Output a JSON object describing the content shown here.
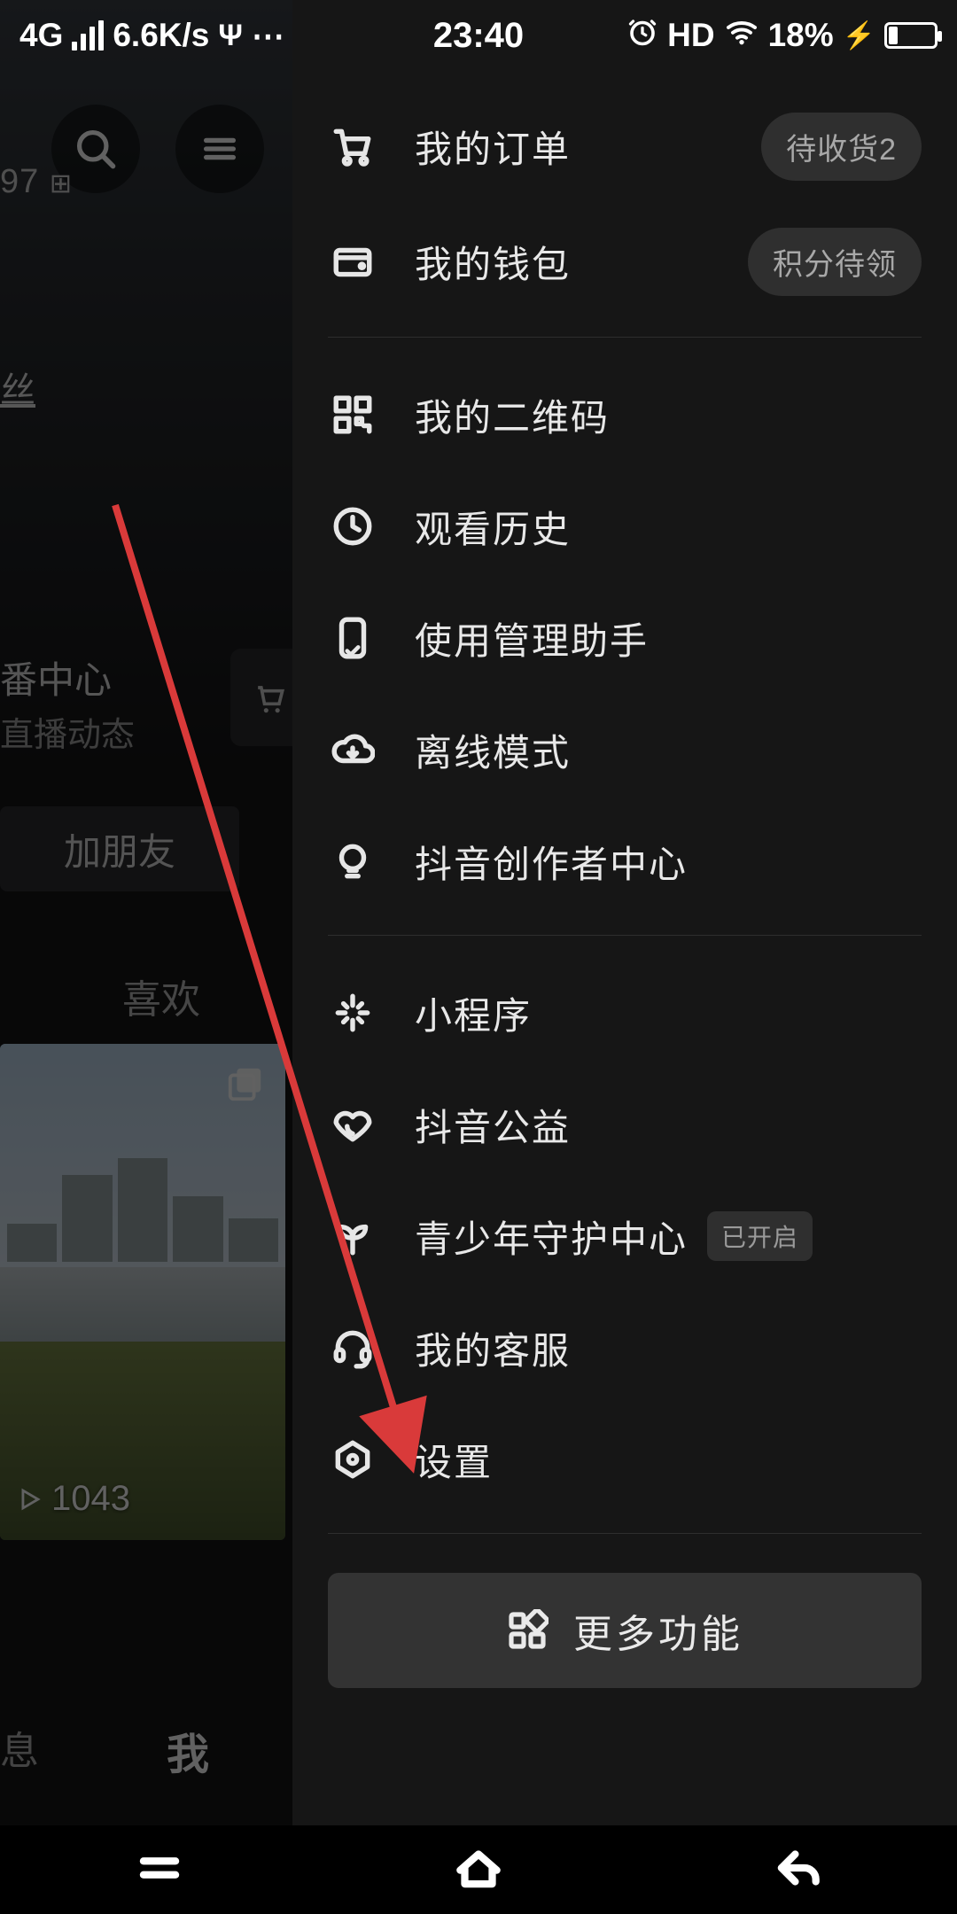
{
  "status_bar": {
    "network_type": "4G",
    "data_rate": "6.6K/s",
    "usb_symbol": "⏆",
    "more_symbol": "⋯",
    "time": "23:40",
    "hd_label": "HD",
    "battery_percent": "18%"
  },
  "background_profile": {
    "small_number": "97",
    "fans_label": "丝",
    "live_title": "番中心",
    "live_subtitle": "直播动态",
    "add_friend_label": "加朋友",
    "tab_like_label": "喜欢",
    "thumb_view_count": "1043",
    "nav_message_label": "息",
    "nav_me_label": "我"
  },
  "drawer": {
    "section1": [
      {
        "key": "orders",
        "label": "我的订单",
        "badge": "待收货2",
        "icon": "cart-icon"
      },
      {
        "key": "wallet",
        "label": "我的钱包",
        "badge": "积分待领",
        "icon": "wallet-icon"
      }
    ],
    "section2": [
      {
        "key": "qrcode",
        "label": "我的二维码",
        "icon": "qrcode-icon"
      },
      {
        "key": "history",
        "label": "观看历史",
        "icon": "clock-icon"
      },
      {
        "key": "assist",
        "label": "使用管理助手",
        "icon": "phone-check-icon"
      },
      {
        "key": "offline",
        "label": "离线模式",
        "icon": "cloud-download-icon"
      },
      {
        "key": "creator",
        "label": "抖音创作者中心",
        "icon": "bulb-icon"
      }
    ],
    "section3": [
      {
        "key": "miniapp",
        "label": "小程序",
        "icon": "spark-icon"
      },
      {
        "key": "charity",
        "label": "抖音公益",
        "icon": "heart-icon"
      },
      {
        "key": "youth",
        "label": "青少年守护中心",
        "icon": "sprout-icon",
        "tag": "已开启"
      },
      {
        "key": "support",
        "label": "我的客服",
        "icon": "headset-icon"
      },
      {
        "key": "settings",
        "label": "设置",
        "icon": "settings-icon"
      }
    ],
    "more_button_label": "更多功能"
  },
  "annotation": {
    "arrow_color": "#d93a3a"
  }
}
